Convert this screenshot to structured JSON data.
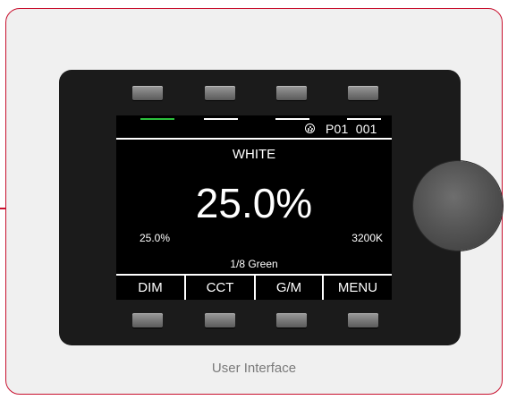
{
  "screen": {
    "mode_title": "WHITE",
    "main_value": "25.0%",
    "left_value": "25.0%",
    "right_value": "3200K",
    "gm_value": "1/8 Green",
    "status": {
      "preset": "P01",
      "address": "001"
    },
    "active_tab_index": 0,
    "menu": [
      "DIM",
      "CCT",
      "G/M",
      "MENU"
    ]
  },
  "caption": "User Interface",
  "colors": {
    "frame_border": "#c8102e",
    "active_indicator": "#2bbf3c",
    "device_body": "#1b1b1b"
  },
  "icons": {
    "dmx": "dmx-connector-icon"
  }
}
